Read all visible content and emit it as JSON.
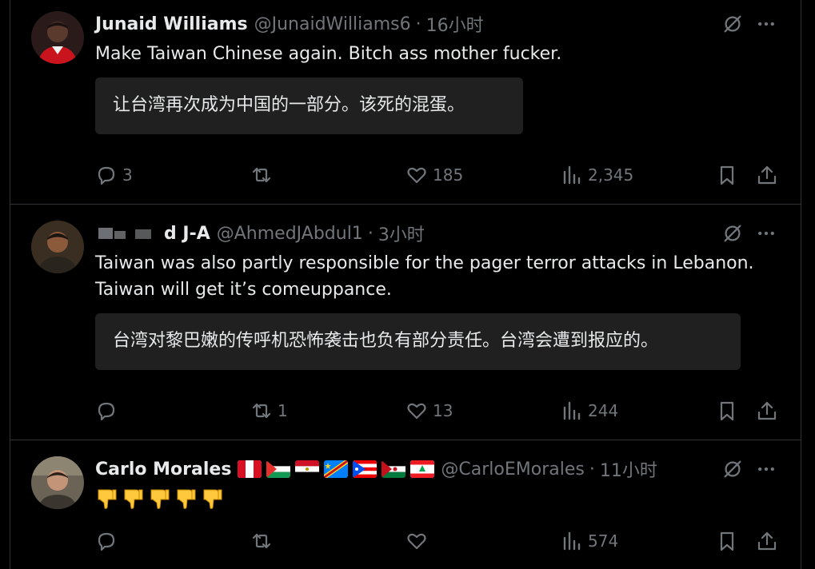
{
  "tweets": [
    {
      "name": "Junaid Williams",
      "handle": "@JunaidWilliams6",
      "time": "16小时",
      "text_lines": [
        "Make Taiwan Chinese again. Bitch ass mother fucker."
      ],
      "translation": "让台湾再次成为中国的一部分。该死的混蛋。",
      "replies": "3",
      "retweets": "",
      "likes": "185",
      "views": "2,345"
    },
    {
      "name": "d J-A",
      "handle": "@AhmedJAbdul1",
      "time": "3小时",
      "text_lines": [
        "Taiwan was also partly responsible for the pager terror attacks in Lebanon.",
        "Taiwan will get it’s comeuppance."
      ],
      "translation": "台湾对黎巴嫩的传呼机恐怖袭击也负有部分责任。台湾会遭到报应的。",
      "replies": "",
      "retweets": "1",
      "likes": "13",
      "views": "244"
    },
    {
      "name": "Carlo Morales",
      "handle": "@CarloEMorales",
      "time": "11小时",
      "emoji": "👎👎👎👎👎",
      "flags": [
        "peru",
        "palestine",
        "egypt",
        "dr-congo",
        "puerto-rico",
        "western-sahara",
        "lebanon"
      ],
      "replies": "",
      "retweets": "",
      "likes": "",
      "views": "574"
    }
  ],
  "separator": "·",
  "colors": {
    "background": "#000000",
    "text": "#e7e9ea",
    "muted": "#71767b",
    "border": "#2f3336",
    "translation_bg": "#202020"
  }
}
